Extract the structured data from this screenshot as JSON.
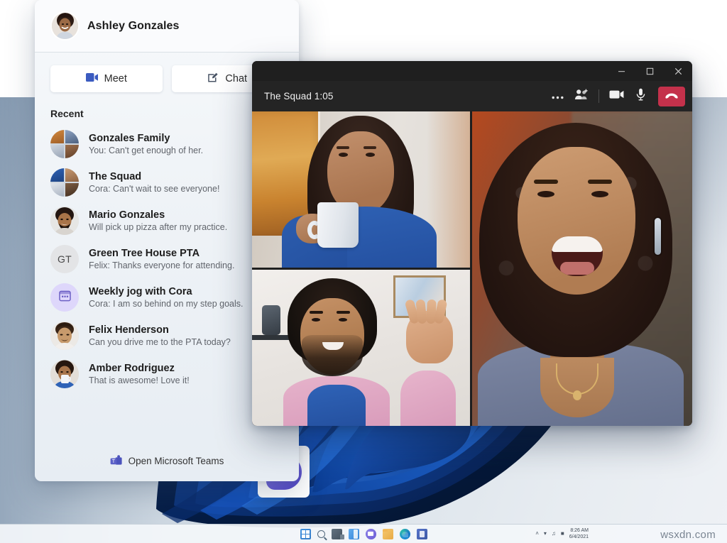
{
  "desktop": {
    "wallpaper_name": "windows-11-bloom",
    "accent_blue": "#1a5fc8",
    "watermark": "wsxdn.com",
    "taskbar": {
      "icons": [
        {
          "name": "start-icon",
          "label": "Start"
        },
        {
          "name": "search-icon",
          "label": "Search"
        },
        {
          "name": "task-view-icon",
          "label": "Task View"
        },
        {
          "name": "widgets-icon",
          "label": "Widgets"
        },
        {
          "name": "teams-chat-icon",
          "label": "Chat"
        },
        {
          "name": "file-explorer-icon",
          "label": "File Explorer"
        },
        {
          "name": "edge-icon",
          "label": "Microsoft Edge"
        },
        {
          "name": "store-icon",
          "label": "Microsoft Store"
        }
      ],
      "tray": {
        "show_hidden": "˄",
        "network": "network-icon",
        "volume": "volume-icon",
        "battery": "battery-icon",
        "time": "8:26 AM",
        "date": "6/4/2021"
      }
    }
  },
  "flyout": {
    "user": {
      "name": "Ashley Gonzales",
      "avatar": "user-avatar"
    },
    "actions": [
      {
        "label": "Meet",
        "icon": "video-camera-icon"
      },
      {
        "label": "Chat",
        "icon": "compose-chat-icon"
      }
    ],
    "recent_heading": "Recent",
    "recent": [
      {
        "name": "Gonzales Family",
        "preview": "You: Can't get enough of her.",
        "avatar_type": "group-quad"
      },
      {
        "name": "The Squad",
        "preview": "Cora: Can't wait to see everyone!",
        "avatar_type": "group-quad"
      },
      {
        "name": "Mario Gonzales",
        "preview": "Will pick up pizza after my practice.",
        "avatar_type": "photo"
      },
      {
        "name": "Green Tree House PTA",
        "preview": "Felix: Thanks everyone for attending.",
        "avatar_type": "initials",
        "initials": "GT"
      },
      {
        "name": "Weekly jog with Cora",
        "preview": "Cora: I am so behind on my step goals.",
        "avatar_type": "calendar",
        "accent": "#ded7fb"
      },
      {
        "name": "Felix Henderson",
        "preview": "Can you drive me to the PTA today?",
        "avatar_type": "photo"
      },
      {
        "name": "Amber Rodriguez",
        "preview": "That is awesome! Love it!",
        "avatar_type": "photo"
      }
    ],
    "footer": {
      "label": "Open Microsoft Teams",
      "icon": "microsoft-teams-logo"
    }
  },
  "meeting_window": {
    "title": "The Squad 1:05",
    "window_controls": [
      {
        "name": "minimize-button",
        "glyph": "—"
      },
      {
        "name": "maximize-button",
        "glyph": "☐"
      },
      {
        "name": "close-button",
        "glyph": "✕"
      }
    ],
    "toolbar": [
      {
        "name": "more-options-button",
        "label": "More options",
        "icon": "ellipsis-icon"
      },
      {
        "name": "add-people-button",
        "label": "Add people",
        "icon": "add-people-icon"
      },
      {
        "name": "camera-toggle",
        "label": "Camera",
        "icon": "video-camera-icon"
      },
      {
        "name": "mic-toggle",
        "label": "Microphone",
        "icon": "microphone-icon"
      },
      {
        "name": "hangup-button",
        "label": "Leave",
        "icon": "hangup-icon",
        "color": "#c4314b"
      }
    ],
    "tiles": [
      {
        "position": "top-left",
        "description": "Woman drinking from a white mug, blue shirt"
      },
      {
        "position": "bottom-left",
        "description": "Man waving, pink shirt over blue tee"
      },
      {
        "position": "right",
        "description": "Laughing woman with curly hair, blue-grey top"
      }
    ]
  },
  "launcher": {
    "name": "teams-chat-launcher",
    "icon": "chat-video-bubble-icon"
  }
}
